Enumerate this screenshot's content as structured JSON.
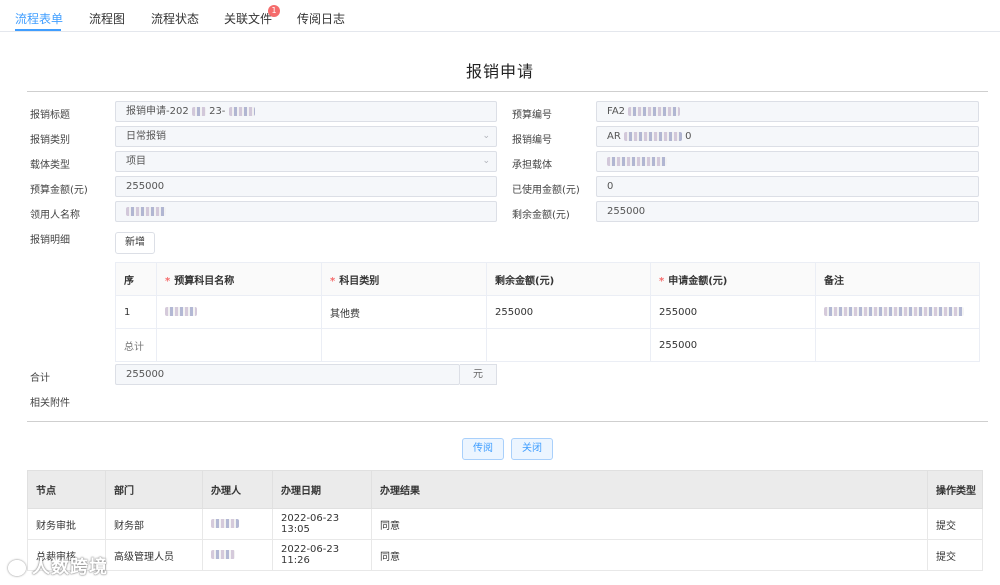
{
  "tabs": [
    {
      "label": "流程表单"
    },
    {
      "label": "流程图"
    },
    {
      "label": "流程状态"
    },
    {
      "label": "关联文件",
      "badge": "1"
    },
    {
      "label": "传阅日志"
    }
  ],
  "title": "报销申请",
  "form": {
    "title_label": "报销标题",
    "title_value_prefix": "报销申请-202",
    "title_value_mid": "23-",
    "type_label": "报销类别",
    "type_value": "日常报销",
    "carrier_type_label": "载体类型",
    "carrier_type_value": "项目",
    "budget_amount_label": "预算金额(元)",
    "budget_amount_value": "255000",
    "recipient_label": "领用人名称",
    "budget_no_label": "预算编号",
    "budget_no_prefix": "FA2",
    "reimb_no_label": "报销编号",
    "reimb_no_prefix": "AR",
    "reimb_no_suffix": "0",
    "bearer_label": "承担载体",
    "used_label": "已使用金额(元)",
    "used_value": "0",
    "remaining_label": "剩余金额(元)",
    "remaining_value": "255000",
    "detail_label": "报销明细",
    "add_button": "新增",
    "total_label": "合计",
    "total_value": "255000",
    "total_unit": "元",
    "attachment_label": "相关附件"
  },
  "detail_table": {
    "headers": [
      "序",
      "预算科目名称",
      "科目类别",
      "剩余金额(元)",
      "申请金额(元)",
      "备注"
    ],
    "required": [
      false,
      true,
      true,
      false,
      true,
      false
    ],
    "rows": [
      {
        "seq": "1",
        "category": "其他费",
        "remaining": "255000",
        "apply": "255000"
      }
    ],
    "total_row": {
      "label": "总计",
      "apply": "255000"
    }
  },
  "actions": {
    "circulate": "传阅",
    "close": "关闭"
  },
  "log_table": {
    "headers": [
      "节点",
      "部门",
      "办理人",
      "办理日期",
      "办理结果",
      "操作类型"
    ],
    "rows": [
      {
        "node": "财务审批",
        "dept": "财务部",
        "date": "2022-06-23 13:05",
        "result": "同意",
        "op": "提交"
      },
      {
        "node": "总裁审核",
        "dept": "高级管理人员",
        "date": "2022-06-23 11:26",
        "result": "同意",
        "op": "提交"
      }
    ]
  },
  "watermark": "人数跨境",
  "colors": {
    "accent": "#409eff",
    "badge": "#f56c6c"
  }
}
